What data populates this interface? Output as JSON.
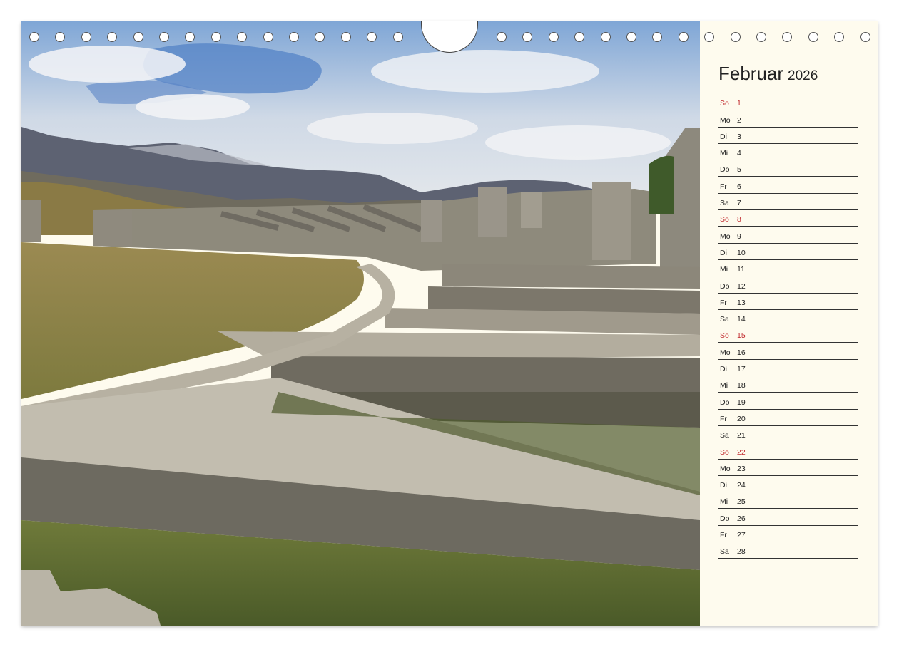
{
  "calendar": {
    "month": "Februar",
    "year": "2026",
    "days": [
      {
        "wd": "So",
        "d": "1",
        "sunday": true
      },
      {
        "wd": "Mo",
        "d": "2"
      },
      {
        "wd": "Di",
        "d": "3"
      },
      {
        "wd": "Mi",
        "d": "4"
      },
      {
        "wd": "Do",
        "d": "5"
      },
      {
        "wd": "Fr",
        "d": "6"
      },
      {
        "wd": "Sa",
        "d": "7"
      },
      {
        "wd": "So",
        "d": "8",
        "sunday": true
      },
      {
        "wd": "Mo",
        "d": "9"
      },
      {
        "wd": "Di",
        "d": "10"
      },
      {
        "wd": "Mi",
        "d": "11"
      },
      {
        "wd": "Do",
        "d": "12"
      },
      {
        "wd": "Fr",
        "d": "13"
      },
      {
        "wd": "Sa",
        "d": "14"
      },
      {
        "wd": "So",
        "d": "15",
        "sunday": true
      },
      {
        "wd": "Mo",
        "d": "16"
      },
      {
        "wd": "Di",
        "d": "17"
      },
      {
        "wd": "Mi",
        "d": "18"
      },
      {
        "wd": "Do",
        "d": "19"
      },
      {
        "wd": "Fr",
        "d": "20"
      },
      {
        "wd": "Sa",
        "d": "21"
      },
      {
        "wd": "So",
        "d": "22",
        "sunday": true
      },
      {
        "wd": "Mo",
        "d": "23"
      },
      {
        "wd": "Di",
        "d": "24"
      },
      {
        "wd": "Mi",
        "d": "25"
      },
      {
        "wd": "Do",
        "d": "26"
      },
      {
        "wd": "Fr",
        "d": "27"
      },
      {
        "wd": "Sa",
        "d": "28"
      }
    ]
  },
  "colors": {
    "sunday": "#c0282c",
    "paper": "#fefbee"
  }
}
